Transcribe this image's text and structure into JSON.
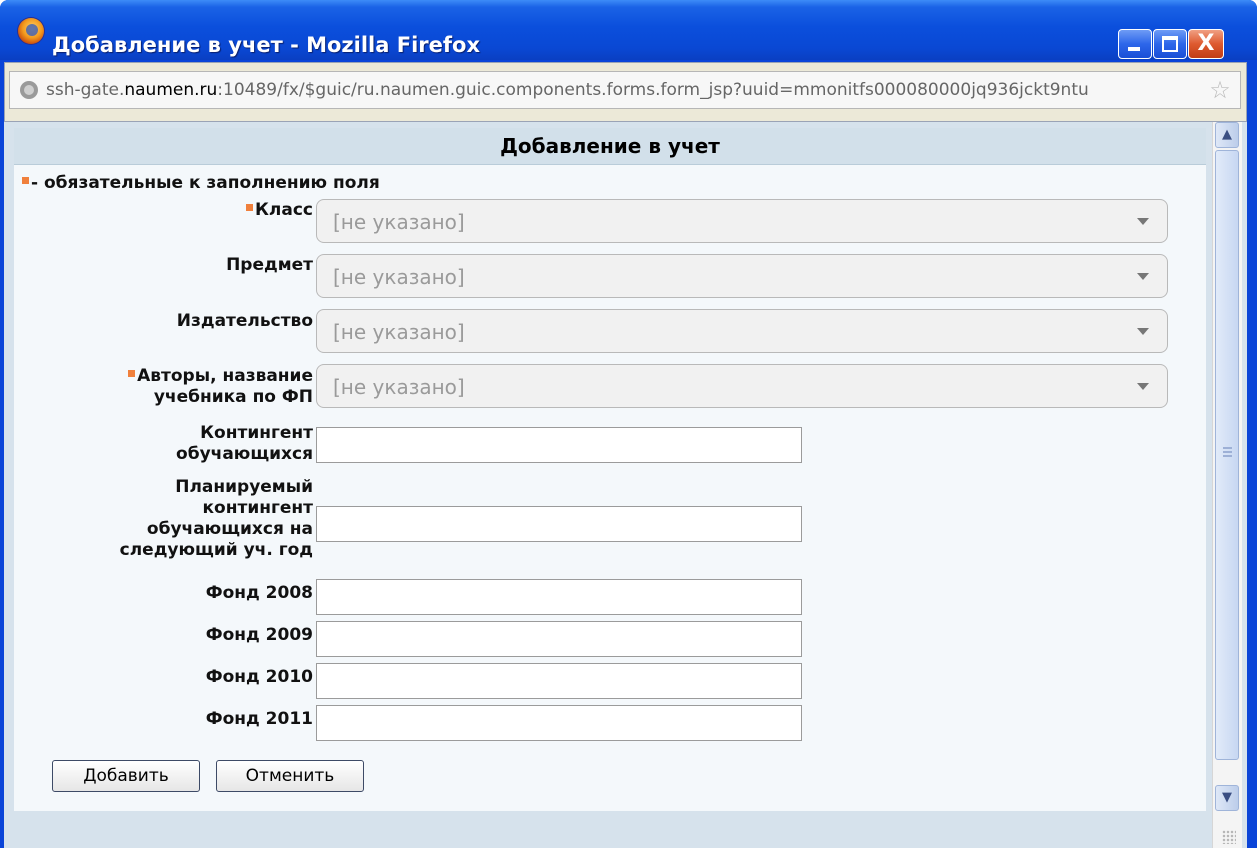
{
  "window": {
    "title": "Добавление в учет - Mozilla Firefox",
    "close_glyph": "X"
  },
  "urlbar": {
    "host_prefix": "ssh-gate.",
    "host_domain": "naumen.ru",
    "rest": ":10489/fx/$guic/ru.naumen.guic.components.forms.form_jsp?uuid=mmonitfs000080000jq936jckt9ntu",
    "star_glyph": "☆"
  },
  "form": {
    "header": "Добавление в учет",
    "required_note": "- обязательные к заполнению поля",
    "fields": {
      "klass": {
        "label": "Класс",
        "value": "[не указано]"
      },
      "predmet": {
        "label": "Предмет",
        "value": "[не указано]"
      },
      "izdatelstvo": {
        "label": "Издательство",
        "value": "[не указано]"
      },
      "avtory": {
        "label_line1": "Авторы, название",
        "label_line2": "учебника по ФП",
        "value": "[не указано]"
      },
      "kontingent": {
        "label_line1": "Контингент",
        "label_line2": "обучающихся",
        "value": ""
      },
      "plan": {
        "line1": "Планируемый",
        "line2": "контингент",
        "line3": "обучающихся на",
        "line4": "следующий уч. год",
        "value": ""
      },
      "fond2008": {
        "label": "Фонд 2008",
        "value": ""
      },
      "fond2009": {
        "label": "Фонд 2009",
        "value": ""
      },
      "fond2010": {
        "label": "Фонд 2010",
        "value": ""
      },
      "fond2011": {
        "label": "Фонд 2011",
        "value": ""
      }
    },
    "buttons": {
      "add": "Добавить",
      "cancel": "Отменить"
    }
  },
  "scrollbar": {
    "up_glyph": "▲",
    "down_glyph": "▼"
  },
  "colors": {
    "required_marker": "#f0803c",
    "titlebar": "#0a48d4"
  }
}
